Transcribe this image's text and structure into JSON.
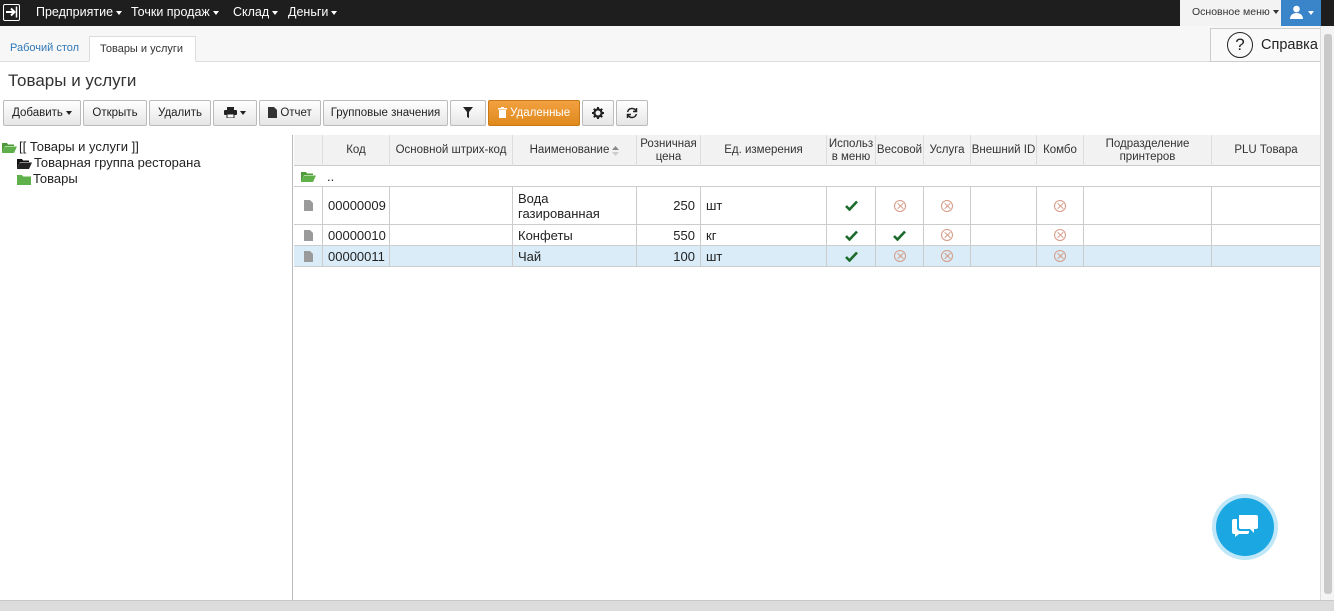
{
  "topbar": {
    "menus": [
      {
        "label": "Предприятие"
      },
      {
        "label": "Точки продаж"
      },
      {
        "label": "Склад"
      },
      {
        "label": "Деньги"
      }
    ],
    "main_menu": "Основное меню"
  },
  "tabs": [
    {
      "label": "Рабочий стол"
    },
    {
      "label": "Товары и услуги"
    }
  ],
  "help_label": "Справка",
  "page_title": "Товары и услуги",
  "toolbar": {
    "add": "Добавить",
    "open": "Открыть",
    "delete": "Удалить",
    "report": "Отчет",
    "group_values": "Групповые значения",
    "deleted": "Удаленные"
  },
  "tree": {
    "root": "[[ Товары и услуги ]]",
    "items": [
      "Товарная группа ресторана",
      "Товары"
    ]
  },
  "grid": {
    "columns": [
      "Код",
      "Основной штрих-код",
      "Наименование",
      "Розничная цена",
      "Ед. измерения",
      "Использ в меню",
      "Весовой",
      "Услуга",
      "Внешний ID",
      "Комбо",
      "Подразделение принтеров",
      "PLU Товара"
    ],
    "parent_row": "..",
    "rows": [
      {
        "code": "00000009",
        "barcode": "",
        "name": "Вода газированная",
        "price": "250",
        "unit": "шт",
        "in_menu": true,
        "weighted": false,
        "service": false,
        "ext_id": "",
        "combo": false,
        "printer": "",
        "plu": ""
      },
      {
        "code": "00000010",
        "barcode": "",
        "name": "Конфеты",
        "price": "550",
        "unit": "кг",
        "in_menu": true,
        "weighted": true,
        "service": false,
        "ext_id": "",
        "combo": false,
        "printer": "",
        "plu": ""
      },
      {
        "code": "00000011",
        "barcode": "",
        "name": "Чай",
        "price": "100",
        "unit": "шт",
        "in_menu": true,
        "weighted": false,
        "service": false,
        "ext_id": "",
        "combo": false,
        "printer": "",
        "plu": "",
        "selected": true
      }
    ]
  },
  "colors": {
    "accent_orange": "#e8921f",
    "selected_row": "#d9ecf7",
    "check_green": "#1c6b2b",
    "chat_blue": "#1ba7e2"
  }
}
